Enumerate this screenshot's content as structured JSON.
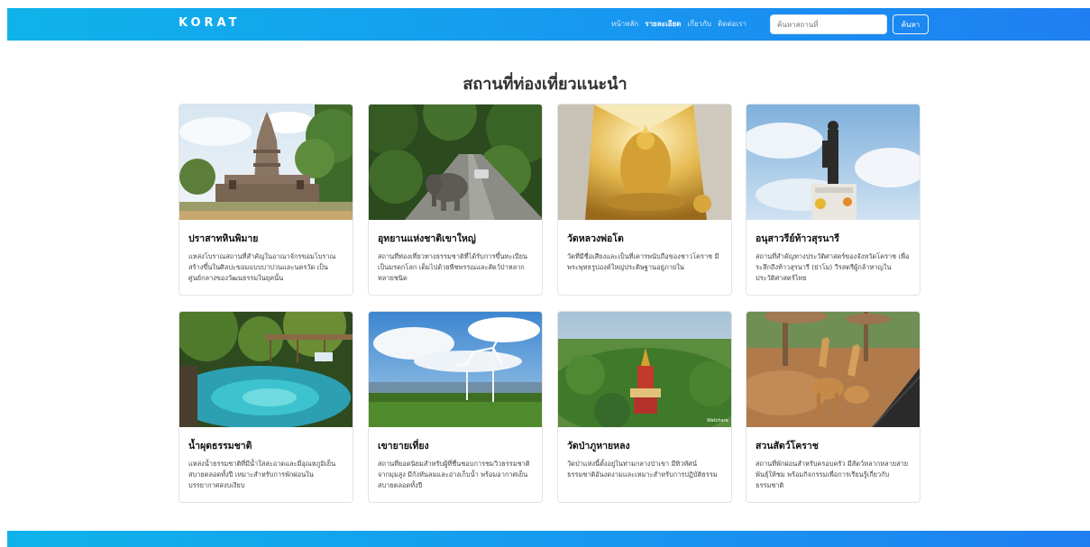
{
  "navbar": {
    "brand": "KORAT",
    "links": [
      {
        "label": "หน้าหลัก",
        "active": false
      },
      {
        "label": "รายละเอียด",
        "active": true
      },
      {
        "label": "เกี่ยวกับ",
        "active": false
      },
      {
        "label": "ติดต่อเรา",
        "active": false
      }
    ],
    "search_placeholder": "ค้นหาสถานที่",
    "search_value": "",
    "search_button": "ค้นหา"
  },
  "main": {
    "title": "สถานที่ท่องเที่ยวแนะนำ",
    "cards": [
      {
        "title": "ปราสาทหินพิมาย",
        "description": "แหล่งโบราณสถานที่สำคัญในอาณาจักรขอมโบราณ สร้างขึ้นในศิลปะขอมแบบบาปวนและนครวัด เป็นศูนย์กลางของวัฒนธรรมในยุคนั้น",
        "image": "stone-temple-photo"
      },
      {
        "title": "อุทยานแห่งชาติเขาใหญ่",
        "description": "สถานที่ท่องเที่ยวทางธรรมชาติที่ได้รับการขึ้นทะเบียนเป็นมรดกโลก เต็มไปด้วยพืชพรรณและสัตว์ป่าหลากหลายชนิด",
        "image": "elephant-road-photo"
      },
      {
        "title": "วัดหลวงพ่อโต",
        "description": "วัดที่มีชื่อเสียงและเป็นที่เคารพนับถือของชาวโคราช มีพระพุทธรูปองค์ใหญ่ประดิษฐานอยู่ภายใน",
        "image": "golden-buddha-photo"
      },
      {
        "title": "อนุสาวรีย์ท้าวสุรนารี",
        "description": "สถานที่สำคัญทางประวัติศาสตร์ของจังหวัดโคราช เพื่อระลึกถึงท้าวสุรนารี (ย่าโม) วีรสตรีผู้กล้าหาญในประวัติศาสตร์ไทย",
        "image": "monument-photo"
      },
      {
        "title": "น้ำผุดธรรมชาติ",
        "description": "แหล่งน้ำธรรมชาติที่มีน้ำใสสะอาดและมีอุณหภูมิเย็นสบายตลอดทั้งปี เหมาะสำหรับการพักผ่อนในบรรยากาศสงบเงียบ",
        "image": "spring-pool-photo"
      },
      {
        "title": "เขายายเที่ยง",
        "description": "สถานที่ยอดนิยมสำหรับผู้ที่ชื่นชอบการชมวิวธรรมชาติจากมุมสูง มีกังหันลมและอ่างเก็บน้ำ พร้อมอากาศเย็นสบายตลอดทั้งปี",
        "image": "wind-turbine-photo"
      },
      {
        "title": "วัดป่าภูหายหลง",
        "description": "วัดป่าแห่งนี้ตั้งอยู่ในท่ามกลางป่าเขา มีทิวทัศน์ธรรมชาติอันงดงามและเหมาะสำหรับการปฏิบัติธรรม",
        "image": "hill-temple-photo"
      },
      {
        "title": "สวนสัตว์โคราช",
        "description": "สถานที่พักผ่อนสำหรับครอบครัว มีสัตว์หลากหลายสายพันธุ์ให้ชม พร้อมกิจกรรมเพื่อการเรียนรู้เกี่ยวกับธรรมชาติ",
        "image": "giraffe-zoo-photo"
      }
    ]
  },
  "colors": {
    "navbar_start": "#0fb3ea",
    "navbar_end": "#1f7ff2",
    "accent_text": "#ffffff"
  }
}
